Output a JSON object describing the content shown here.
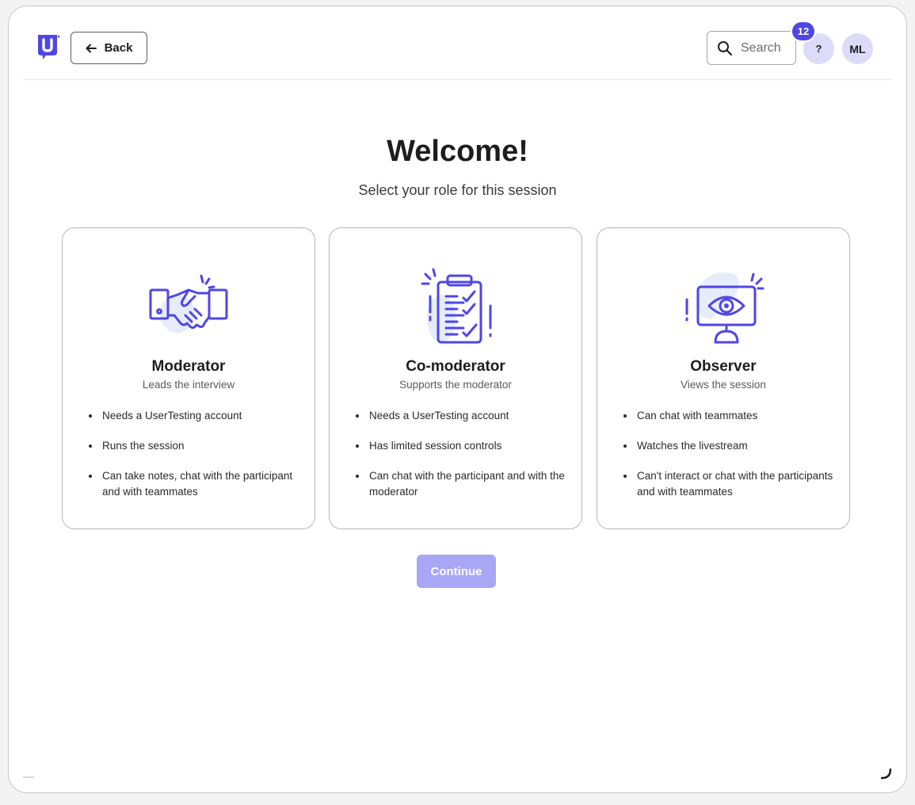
{
  "header": {
    "logo_letter": "U",
    "back_label": "Back",
    "search_placeholder": "Search",
    "help_label": "?",
    "notification_count": "12",
    "avatar_initials": "ML"
  },
  "main": {
    "title": "Welcome!",
    "subtitle": "Select your role for this session",
    "continue_label": "Continue"
  },
  "roles": [
    {
      "icon": "handshake-icon",
      "title": "Moderator",
      "subtitle": "Leads the interview",
      "bullets": [
        "Needs a UserTesting account",
        "Runs the session",
        "Can take notes, chat with the participant and with teammates"
      ]
    },
    {
      "icon": "clipboard-checklist-icon",
      "title": "Co-moderator",
      "subtitle": "Supports the moderator",
      "bullets": [
        "Needs a UserTesting account",
        "Has limited session controls",
        "Can chat with the participant and with the moderator"
      ]
    },
    {
      "icon": "monitor-eye-icon",
      "title": "Observer",
      "subtitle": "Views the session",
      "bullets": [
        "Can chat with teammates",
        "Watches the livestream",
        "Can't interact or chat with the participants and with teammates"
      ]
    }
  ],
  "colors": {
    "brand": "#4f46e5",
    "icon_stroke": "#4f46e5",
    "icon_blob": "#e6ecfb",
    "continue_disabled": "#a9a6f5",
    "avatar_bg": "#dcdcfa"
  }
}
